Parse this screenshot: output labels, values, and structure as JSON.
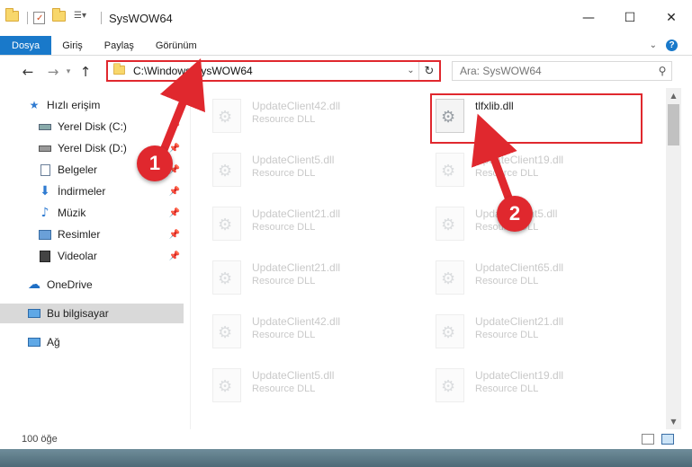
{
  "window": {
    "title": "SysWOW64",
    "controls": {
      "minimize": "—",
      "maximize": "☐",
      "close": "✕"
    }
  },
  "ribbon": {
    "tabs": [
      {
        "label": "Dosya"
      },
      {
        "label": "Giriş"
      },
      {
        "label": "Paylaş"
      },
      {
        "label": "Görünüm"
      }
    ],
    "help": "?"
  },
  "nav": {
    "address": "C:\\Windows\\SysWOW64",
    "search_placeholder": "Ara: SysWOW64"
  },
  "sidebar": {
    "items": [
      {
        "label": "Hızlı erişim",
        "icon": "star-icon",
        "pinned": false
      },
      {
        "label": "Yerel Disk (C:)",
        "icon": "drive-icon",
        "pinned": true
      },
      {
        "label": "Yerel Disk (D:)",
        "icon": "drive-icon",
        "pinned": true
      },
      {
        "label": "Belgeler",
        "icon": "document-icon",
        "pinned": true
      },
      {
        "label": "İndirmeler",
        "icon": "download-icon",
        "pinned": true
      },
      {
        "label": "Müzik",
        "icon": "music-icon",
        "pinned": true
      },
      {
        "label": "Resimler",
        "icon": "picture-icon",
        "pinned": true
      },
      {
        "label": "Videolar",
        "icon": "video-icon",
        "pinned": true
      },
      {
        "label": "OneDrive",
        "icon": "cloud-icon",
        "pinned": false
      },
      {
        "label": "Bu bilgisayar",
        "icon": "computer-icon",
        "pinned": false,
        "selected": true
      },
      {
        "label": "Ağ",
        "icon": "network-icon",
        "pinned": false
      }
    ]
  },
  "files": {
    "left_column": [
      {
        "name": "UpdateClient42.dll",
        "type": "Resource DLL"
      },
      {
        "name": "UpdateClient5.dll",
        "type": "Resource DLL"
      },
      {
        "name": "UpdateClient21.dll",
        "type": "Resource DLL"
      },
      {
        "name": "UpdateClient21.dll",
        "type": "Resource DLL"
      },
      {
        "name": "UpdateClient42.dll",
        "type": "Resource DLL"
      },
      {
        "name": "UpdateClient5.dll",
        "type": "Resource DLL"
      }
    ],
    "right_column": [
      {
        "name": "tlfxlib.dll",
        "type": "",
        "highlighted": true
      },
      {
        "name": "UpdateClient19.dll",
        "type": "Resource DLL"
      },
      {
        "name": "UpdateClient5.dll",
        "type": "Resource DLL"
      },
      {
        "name": "UpdateClient65.dll",
        "type": "Resource DLL"
      },
      {
        "name": "UpdateClient21.dll",
        "type": "Resource DLL"
      },
      {
        "name": "UpdateClient19.dll",
        "type": "Resource DLL"
      }
    ]
  },
  "status": {
    "item_count": "100 öğe"
  },
  "annotations": {
    "step1": "1",
    "step2": "2",
    "color": "#e0282e"
  }
}
